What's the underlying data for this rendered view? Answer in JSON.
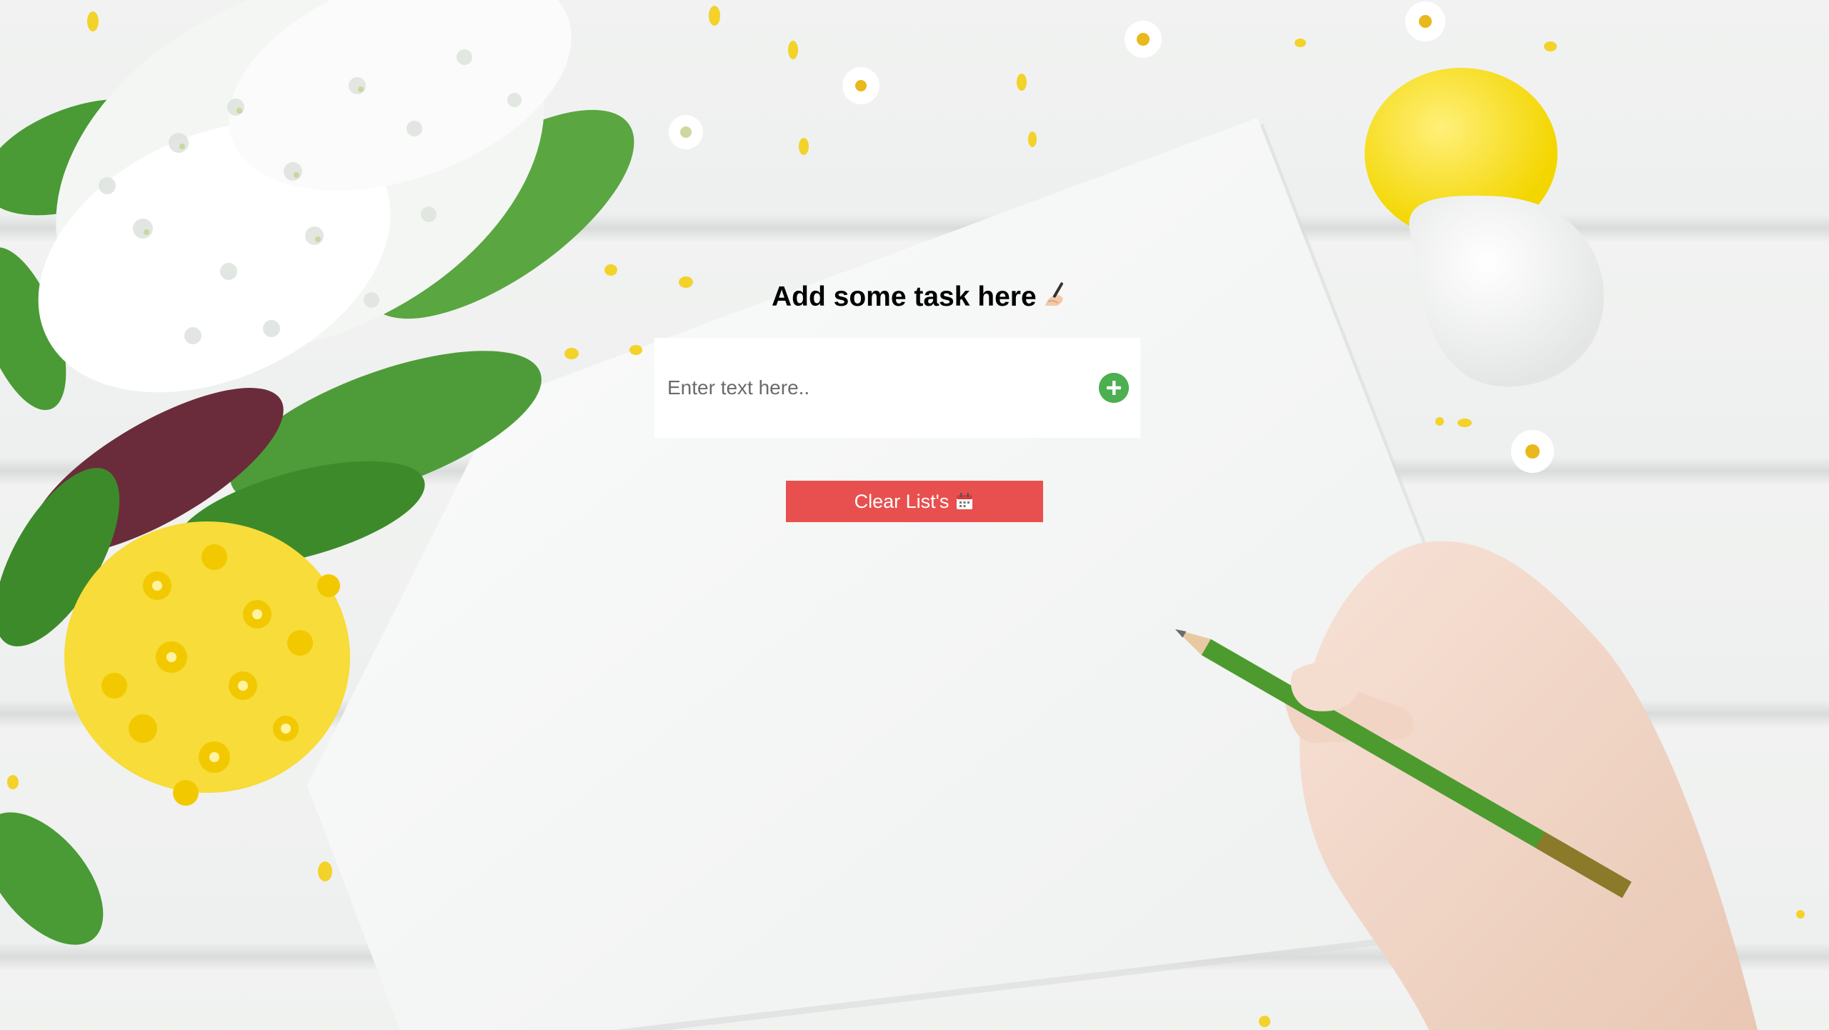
{
  "app": {
    "heading": "Add some task here",
    "heading_icon": "writing-hand-icon"
  },
  "task_input": {
    "placeholder": "Enter text here..",
    "value": ""
  },
  "add_button": {
    "icon": "plus-circle-icon",
    "color": "#4caf50"
  },
  "clear_button": {
    "label": "Clear List's",
    "icon": "calendar-icon",
    "color": "#e8504f"
  },
  "background": {
    "description_icon": "desk-flowers-paper-photo"
  }
}
